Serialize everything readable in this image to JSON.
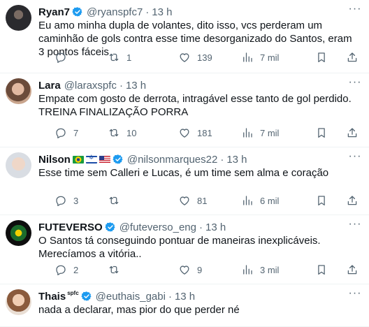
{
  "tweets": [
    {
      "name": "Ryan7",
      "verified": true,
      "handle": "@ryanspfc7",
      "time": "13 h",
      "text": "Eu amo minha dupla de volantes, dito isso, vcs perderam um caminhão de gols contra esse time desorganizado do Santos, eram 3 pontos fáceis",
      "replies": "",
      "retweets": "1",
      "likes": "139",
      "views": "7 mil"
    },
    {
      "name": "Lara",
      "verified": false,
      "handle": "@laraxspfc",
      "time": "13 h",
      "text_lines": [
        "Empate com gosto de derrota, intragável esse tanto de gol perdido.",
        "TREINA FINALIZAÇÃO PORRA"
      ],
      "replies": "7",
      "retweets": "10",
      "likes": "181",
      "views": "7 mil"
    },
    {
      "name": "Nilson",
      "verified": true,
      "handle": "@nilsonmarques22",
      "time": "13 h",
      "flags": [
        "brazil-flag",
        "israel-flag",
        "usa-flag"
      ],
      "text": "Esse time sem Calleri e Lucas, é um time sem alma e coração",
      "replies": "3",
      "retweets": "",
      "likes": "81",
      "views": "6 mil"
    },
    {
      "name": "FUTEVERSO",
      "verified": true,
      "handle": "@futeverso_eng",
      "time": "13 h",
      "text": "O Santos tá conseguindo pontuar de maneiras inexplicáveis. Merecíamos a vitória..",
      "replies": "2",
      "retweets": "",
      "likes": "9",
      "views": "3 mil"
    },
    {
      "name": "Thais",
      "name_sup": "spfc",
      "verified": true,
      "handle": "@euthais_gabi",
      "time": "13 h",
      "text": "nada a declarar, mas pior do que perder né"
    }
  ],
  "separator": "·",
  "colors": {
    "verified": "#1d9bf0",
    "text": "#0f1419",
    "secondary": "#536471",
    "divider": "#eff3f4"
  }
}
